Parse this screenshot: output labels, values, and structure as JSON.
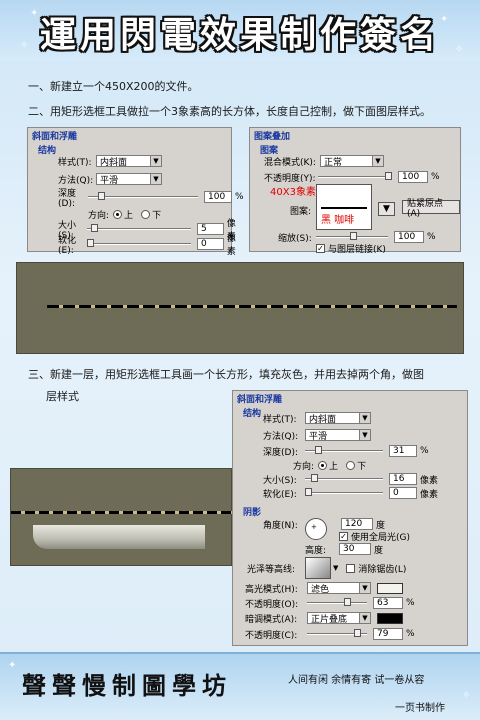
{
  "title": "運用閃電效果制作簽名",
  "steps": {
    "one": "一、新建立一个450X200的文件。",
    "two": "二、用矩形选框工具做拉一个3象素高的长方体，长度自己控制，做下面图层样式。",
    "three_line1": "三、新建一层，用矩形选框工具画一个长方形，填充灰色，并用去掉两个角，做图",
    "three_line2": "层样式"
  },
  "bevel_panel_1": {
    "header": "斜面和浮雕",
    "section": "结构",
    "style_label": "样式(T):",
    "style_value": "内斜面",
    "method_label": "方法(Q):",
    "method_value": "平滑",
    "depth_label": "深度(D):",
    "depth_value": "100",
    "depth_unit": "%",
    "direction_label": "方向:",
    "dir_up": "上",
    "dir_down": "下",
    "size_label": "大小(S):",
    "size_value": "5",
    "size_unit": "像素",
    "soften_label": "软化(E):",
    "soften_value": "0",
    "soften_unit": "像素"
  },
  "pattern_panel": {
    "header": "图案叠加",
    "section": "图案",
    "blend_label": "混合模式(K):",
    "blend_value": "正常",
    "opacity_label": "不透明度(Y):",
    "opacity_value": "100",
    "opacity_unit": "%",
    "pattern_label": "图案:",
    "annotation_size": "40X3象素",
    "annotation_colors": "黑  咖啡",
    "snap_button": "贴紧原点(A)",
    "scale_label": "缩放(S):",
    "scale_value": "100",
    "scale_unit": "%",
    "link_label": "与图层链接(K)"
  },
  "bevel_panel_2": {
    "header": "斜面和浮雕",
    "section": "结构",
    "style_label": "样式(T):",
    "style_value": "内斜面",
    "method_label": "方法(Q):",
    "method_value": "平滑",
    "depth_label": "深度(D):",
    "depth_value": "31",
    "depth_unit": "%",
    "direction_label": "方向:",
    "dir_up": "上",
    "dir_down": "下",
    "size_label": "大小(S):",
    "size_value": "16",
    "size_unit": "像素",
    "soften_label": "软化(E):",
    "soften_value": "0",
    "soften_unit": "像素",
    "shading_section": "阴影",
    "angle_label": "角度(N):",
    "angle_value": "120",
    "angle_unit": "度",
    "global_light_label": "使用全局光(G)",
    "altitude_label": "高度:",
    "altitude_value": "30",
    "altitude_unit": "度",
    "gloss_label": "光泽等高线:",
    "antialias_label": "消除锯齿(L)",
    "highlight_label": "高光模式(H):",
    "highlight_value": "滤色",
    "hl_opacity_label": "不透明度(O):",
    "hl_opacity_value": "63",
    "hl_opacity_unit": "%",
    "shadow_label": "暗调模式(A):",
    "shadow_value": "正片叠底",
    "sh_opacity_label": "不透明度(C):",
    "sh_opacity_value": "79",
    "sh_opacity_unit": "%"
  },
  "footer": {
    "studio": "聲聲慢制圖學坊",
    "motto": "人间有闲  余情有寄  试一卷从容",
    "credit": "一页书制作"
  },
  "colors": {
    "accent_blue": "#1c3aa0",
    "annotation_red": "#e00000",
    "canvas_olive": "#6e6c57"
  }
}
